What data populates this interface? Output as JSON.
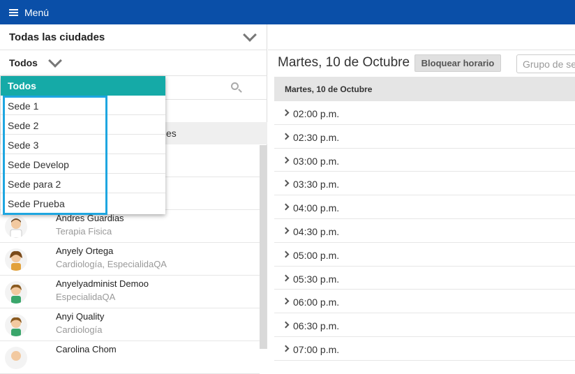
{
  "topbar": {
    "menu_label": "Menú"
  },
  "filters": {
    "city": "Todas las ciudades",
    "site": "Todos"
  },
  "dropdown": {
    "header": "Todos",
    "items": [
      "Sede 1",
      "Sede 2",
      "Sede 3",
      "Sede Develop",
      "Sede para 2",
      "Sede Prueba"
    ]
  },
  "partial_row_text": "es",
  "doctors": [
    {
      "name": "Andres Guardias",
      "specialty": "Terapia Fisica"
    },
    {
      "name": "Anyely Ortega",
      "specialty": "Cardiología, EspecialidaQA"
    },
    {
      "name": "Anyelyadminist Demoo",
      "specialty": "EspecialidaQA"
    },
    {
      "name": "Anyi Quality",
      "specialty": "Cardiología"
    },
    {
      "name": "Carolina Chom",
      "specialty": ""
    }
  ],
  "schedule": {
    "date_title": "Martes, 10 de Octubre",
    "block_button": "Bloquear horario",
    "group_placeholder": "Grupo de se",
    "day_header": "Martes, 10 de Octubre",
    "slots": [
      "02:00 p.m.",
      "02:30 p.m.",
      "03:00 p.m.",
      "03:30 p.m.",
      "04:00 p.m.",
      "04:30 p.m.",
      "05:00 p.m.",
      "05:30 p.m.",
      "06:00 p.m.",
      "06:30 p.m.",
      "07:00 p.m."
    ]
  },
  "colors": {
    "topbar": "#0a4fa8",
    "dropdown_header": "#15aaa7",
    "highlight": "#1ea6e0"
  }
}
